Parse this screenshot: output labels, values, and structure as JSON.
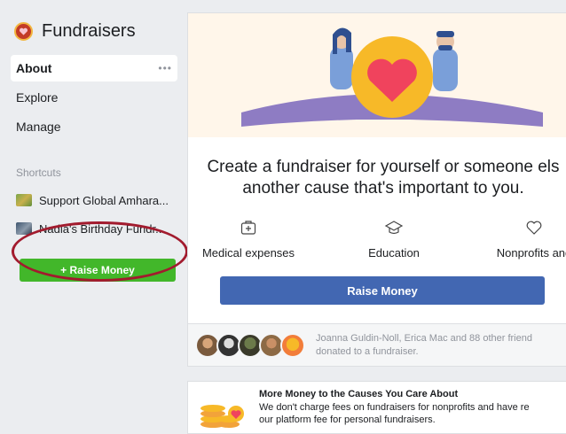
{
  "sidebar": {
    "app_title": "Fundraisers",
    "app_icon": "fundraiser-heart-icon",
    "nav": [
      {
        "label": "About",
        "active": true,
        "more": "•••"
      },
      {
        "label": "Explore"
      },
      {
        "label": "Manage"
      }
    ],
    "shortcuts_label": "Shortcuts",
    "shortcuts": [
      {
        "label": "Support Global Amhara..."
      },
      {
        "label": "Nadia's Birthday Fundr..."
      }
    ],
    "raise_button": "+ Raise Money"
  },
  "main": {
    "headline_line1": "Create a fundraiser for yourself or someone els",
    "headline_line2": "another cause that's important to you.",
    "categories": [
      {
        "label": "Medical expenses",
        "icon": "medical-kit-icon"
      },
      {
        "label": "Education",
        "icon": "graduation-cap-icon"
      },
      {
        "label": "Nonprofits and",
        "icon": "heart-outline-icon"
      }
    ],
    "raise_button": "Raise Money",
    "social_line1": "Joanna Guldin-Noll, Erica Mac and 88 other friend",
    "social_line2": "donated to a fundraiser.",
    "promo_title": "More Money to the Causes You Care About",
    "promo_line1": "We don't charge fees on fundraisers for nonprofits and have re",
    "promo_line2": "our platform fee for personal fundraisers."
  },
  "colors": {
    "primary_blue": "#4267b2",
    "green": "#42b72a",
    "annotation_red": "#a21b2e",
    "heart_red": "#f0435d",
    "hero_yellow": "#f7b928",
    "illustration_purple": "#8e7cc3"
  }
}
